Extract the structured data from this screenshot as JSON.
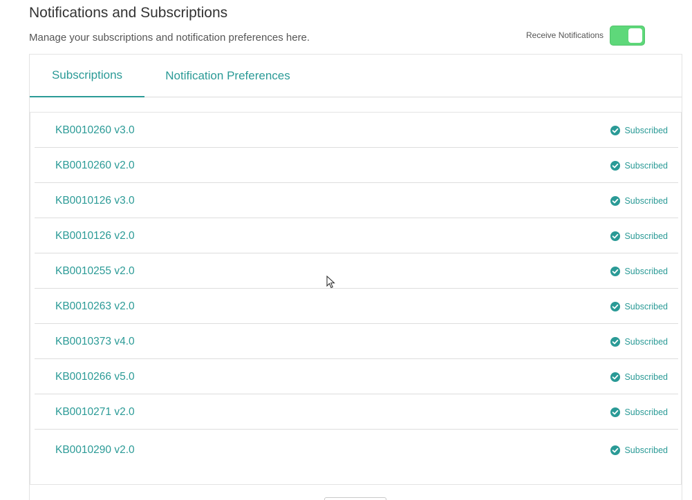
{
  "header": {
    "title": "Notifications and Subscriptions",
    "subtitle": "Manage your subscriptions and notification preferences here."
  },
  "receive_notifications": {
    "label": "Receive Notifications",
    "enabled": true,
    "toggle_color": "#5ed87a"
  },
  "tabs": [
    {
      "label": "Subscriptions",
      "active": true
    },
    {
      "label": "Notification Preferences",
      "active": false
    }
  ],
  "subscriptions": [
    {
      "name": "KB0010260 v3.0",
      "status": "Subscribed"
    },
    {
      "name": "KB0010260 v2.0",
      "status": "Subscribed"
    },
    {
      "name": "KB0010126 v3.0",
      "status": "Subscribed"
    },
    {
      "name": "KB0010126 v2.0",
      "status": "Subscribed"
    },
    {
      "name": "KB0010255 v2.0",
      "status": "Subscribed"
    },
    {
      "name": "KB0010263 v2.0",
      "status": "Subscribed"
    },
    {
      "name": "KB0010373 v4.0",
      "status": "Subscribed"
    },
    {
      "name": "KB0010266 v5.0",
      "status": "Subscribed"
    },
    {
      "name": "KB0010271 v2.0",
      "status": "Subscribed"
    },
    {
      "name": "KB0010290 v2.0",
      "status": "Subscribed"
    }
  ],
  "colors": {
    "accent": "#2a9a96",
    "toggle_on": "#5ed87a"
  },
  "icons": {
    "status": "check-circle-icon",
    "pointer": "mouse-pointer-icon"
  }
}
